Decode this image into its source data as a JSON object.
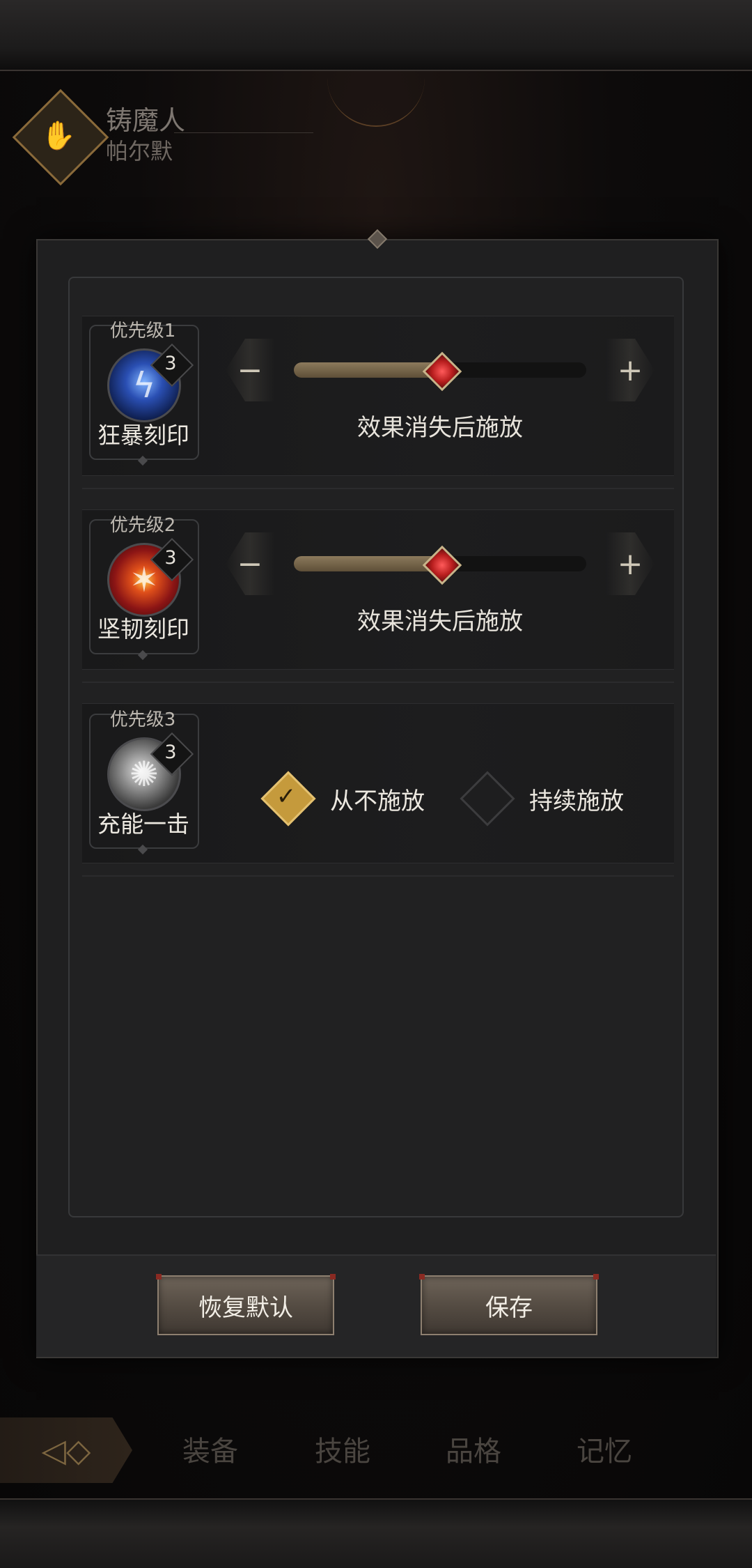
{
  "character": {
    "class_name": "铸魔人",
    "name": "帕尔默"
  },
  "bottom_nav": {
    "items": [
      "装备",
      "技能",
      "品格",
      "记忆"
    ]
  },
  "rows": [
    {
      "priority": "优先级1",
      "skill_name": "狂暴刻印",
      "level": "3",
      "control": "slider",
      "slider_value": 0.5,
      "status": "效果消失后施放",
      "icon": "lightning-orb-icon"
    },
    {
      "priority": "优先级2",
      "skill_name": "坚韧刻印",
      "level": "3",
      "control": "slider",
      "slider_value": 0.5,
      "status": "效果消失后施放",
      "icon": "fire-sigil-icon"
    },
    {
      "priority": "优先级3",
      "skill_name": "充能一击",
      "level": "3",
      "control": "options",
      "options": [
        {
          "label": "从不施放",
          "checked": true
        },
        {
          "label": "持续施放",
          "checked": false
        }
      ],
      "icon": "strike-orb-icon"
    }
  ],
  "buttons": {
    "reset": "恢复默认",
    "save": "保存"
  },
  "colors": {
    "accent_gold": "#c59a3c",
    "knob_red": "#d22a2a"
  }
}
